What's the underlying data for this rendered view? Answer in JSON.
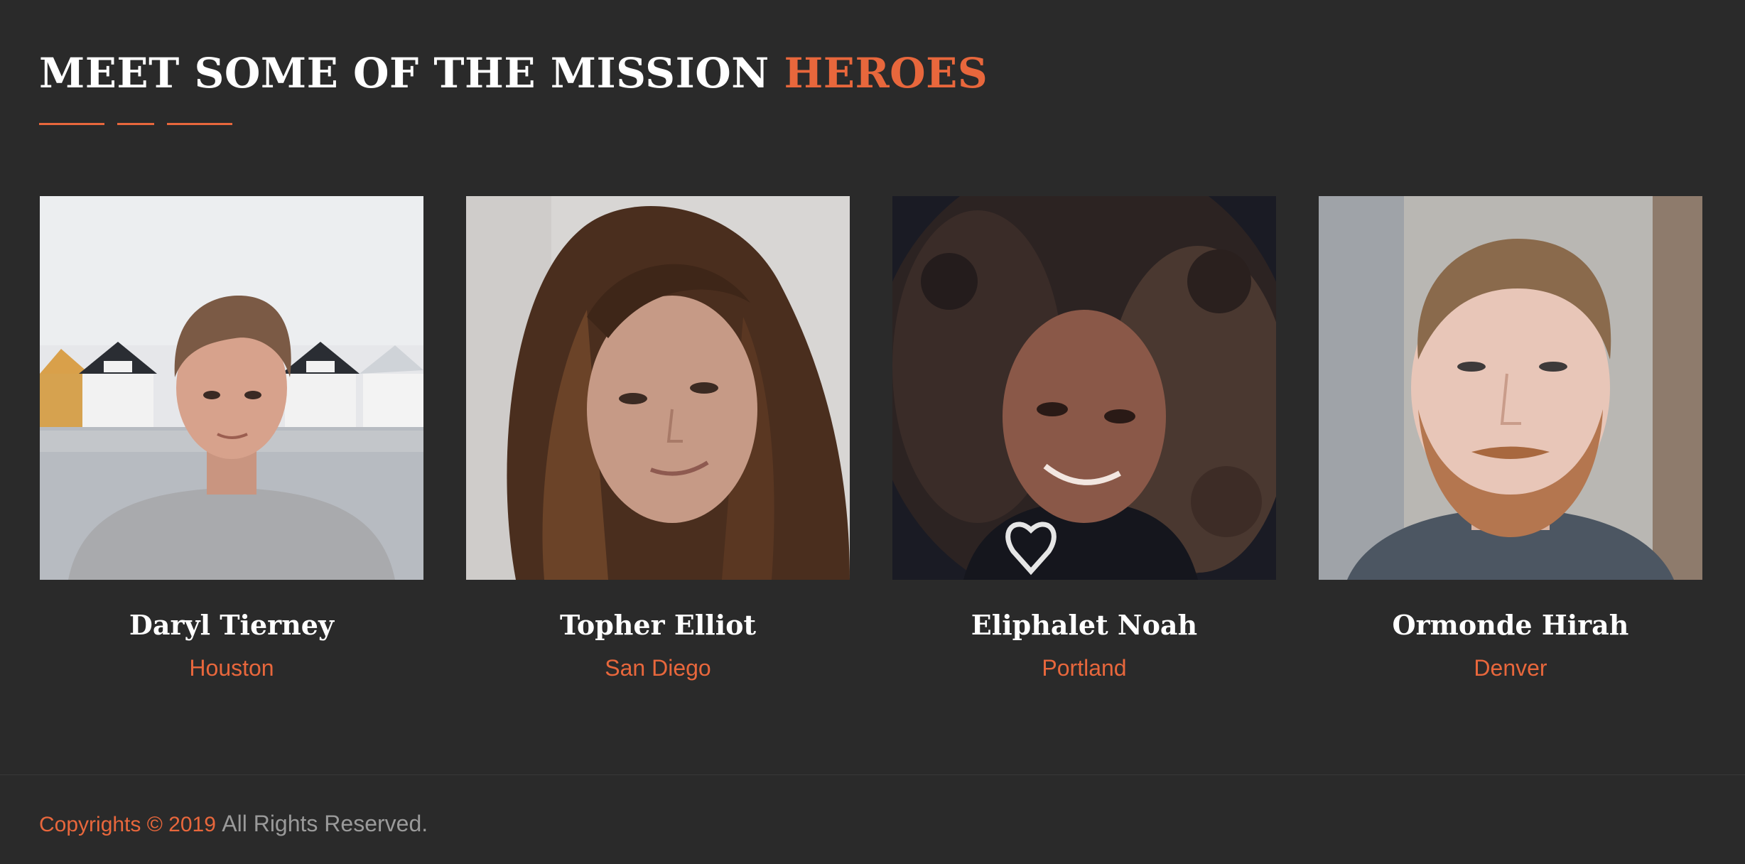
{
  "heading": {
    "main": "MEET SOME OF THE MISSION",
    "accent": "HEROES"
  },
  "colors": {
    "background": "#2a2a2a",
    "accent": "#e8673c",
    "text": "#ffffff",
    "muted": "#9a9a9a"
  },
  "heroes": [
    {
      "name": "Daryl Tierney",
      "city": "Houston",
      "photo": "portrait-young-man-by-boathouses"
    },
    {
      "name": "Topher Elliot",
      "city": "San Diego",
      "photo": "portrait-woman-long-brown-hair"
    },
    {
      "name": "Eliphalet Noah",
      "city": "Portland",
      "photo": "portrait-woman-curly-hair-heart-necklace"
    },
    {
      "name": "Ormonde Hirah",
      "city": "Denver",
      "photo": "portrait-man-red-beard"
    }
  ],
  "footer": {
    "copyright": "Copyrights © 2019",
    "rights": "All Rights Reserved."
  }
}
